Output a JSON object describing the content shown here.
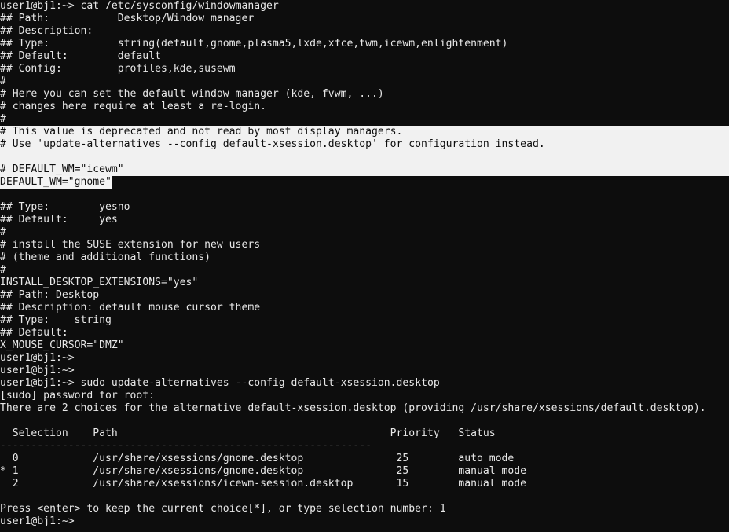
{
  "terminal": {
    "window_title": "user1@bj1:~>",
    "colors": {
      "background": "#0d0d0d",
      "foreground": "#e8e8e8",
      "highlight_background": "#f1f1f1",
      "highlight_foreground": "#0d0d0d",
      "mark_background": "#f4f4f4",
      "mark_foreground": "#111111"
    },
    "prompt": "user1@bj1:~>",
    "cols": 118,
    "rows": 42
  },
  "commands": [
    {
      "prompt": "user1@bj1:~>",
      "command": "cat /etc/sysconfig/windowmanager"
    },
    {
      "prompt": "user1@bj1:~>",
      "command": "sudo update-alternatives --config default-xsession.desktop"
    }
  ],
  "file_contents": {
    "path": "/etc/sysconfig/windowmanager",
    "header": [
      "## Path:           Desktop/Window manager",
      "## Description:",
      "## Type:           string(default,gnome,plasma5,lxde,xfce,twm,icewm,enlightenment)",
      "## Default:        default",
      "## Config:         profiles,kde,susewm",
      "#",
      "# Here you can set the default window manager (kde, fvwm, ...)",
      "# changes here require at least a re-login.",
      "#"
    ],
    "highlighted_block": [
      "# This value is deprecated and not read by most display managers.",
      "# Use 'update-alternatives --config default-xsession.desktop' for configuration instead.",
      "",
      "# DEFAULT_WM=\"icewm\""
    ],
    "marked_line": "DEFAULT_WM=\"gnome\"",
    "tail": [
      "",
      "## Type:        yesno",
      "## Default:     yes",
      "#",
      "# install the SUSE extension for new users",
      "# (theme and additional functions)",
      "#",
      "INSTALL_DESKTOP_EXTENSIONS=\"yes\"",
      "## Path: Desktop",
      "## Description: default mouse cursor theme",
      "## Type:    string",
      "## Default:",
      "X_MOUSE_CURSOR=\"DMZ\""
    ]
  },
  "update_alternatives": {
    "sudo_prompt": "[sudo] password for root:",
    "intro": "There are 2 choices for the alternative default-xsession.desktop (providing /usr/share/xsessions/default.desktop).",
    "blank": "",
    "header_row": "  Selection    Path                                            Priority   Status",
    "separator": "------------------------------------------------------------",
    "rows": [
      "  0            /usr/share/xsessions/gnome.desktop               25        auto mode",
      "* 1            /usr/share/xsessions/gnome.desktop               25        manual mode",
      "  2            /usr/share/xsessions/icewm-session.desktop       15        manual mode"
    ],
    "table": {
      "columns": [
        "Selection",
        "Path",
        "Priority",
        "Status"
      ],
      "entries": [
        {
          "marker": "",
          "selection": "0",
          "path": "/usr/share/xsessions/gnome.desktop",
          "priority": "25",
          "status": "auto mode"
        },
        {
          "marker": "*",
          "selection": "1",
          "path": "/usr/share/xsessions/gnome.desktop",
          "priority": "25",
          "status": "manual mode"
        },
        {
          "marker": "",
          "selection": "2",
          "path": "/usr/share/xsessions/icewm-session.desktop",
          "priority": "15",
          "status": "manual mode"
        }
      ]
    },
    "choice_prompt": "Press <enter> to keep the current choice[*], or type selection number: 1"
  },
  "idle_prompts": [
    "user1@bj1:~>",
    "user1@bj1:~>"
  ],
  "final_prompt": "user1@bj1:~>"
}
